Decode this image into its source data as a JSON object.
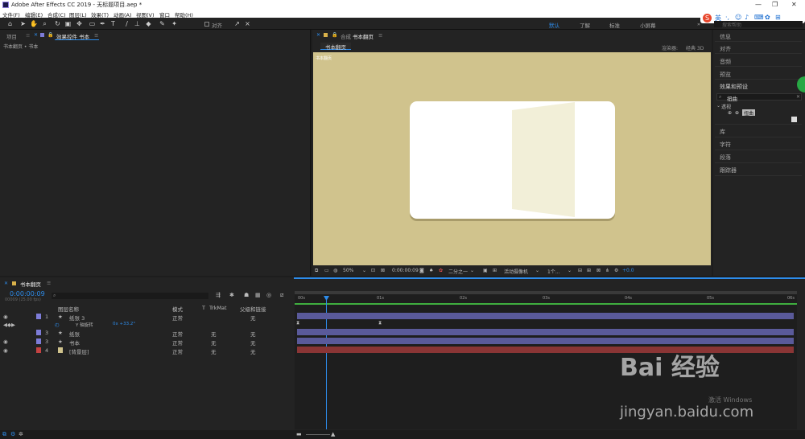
{
  "titlebar": {
    "title": "Adobe After Effects CC 2019 - 无标题项目.aep *",
    "min": "—",
    "max": "❐",
    "close": "✕"
  },
  "menu": [
    "文件(F)",
    "编辑(E)",
    "合成(C)",
    "图层(L)",
    "效果(T)",
    "动画(A)",
    "视图(V)",
    "窗口",
    "帮助(H)"
  ],
  "toolbar": {
    "snap_label": "对齐",
    "workspaces": [
      "默认",
      "了解",
      "标准",
      "小屏幕"
    ],
    "search_placeholder": "搜索帮助"
  },
  "left_panel": {
    "tabs": [
      "项目",
      "效果控件 书本"
    ],
    "breadcrumb": "书本翻页 • 书本"
  },
  "comp_panel": {
    "tab_prefix": "合成",
    "tab_name": "书本翻页",
    "subtab": "书本翻页",
    "renderer_label": "渲染器:",
    "renderer_value": "经典 3D",
    "camera_label": "活动摄像机",
    "zoom": "50%",
    "timecode": "0:00:00:09",
    "resolution": "二分之一",
    "views": "1个...",
    "exposure": "+0.0"
  },
  "right_panel": {
    "items": [
      "信息",
      "对齐",
      "音频",
      "预览",
      "效果和预设",
      "库",
      "字符",
      "段落",
      "跟踪器"
    ],
    "effects_search": "扭曲",
    "effects_folder": "透视"
  },
  "timeline": {
    "tab_label": "书本翻页",
    "timecode": "0:00:00:09",
    "fps_info": "00009 (25.00 fps)",
    "search_placeholder": "",
    "columns": {
      "layer_name": "图层名称",
      "mode": "模式",
      "t": "T",
      "trkmat": "TrkMat",
      "parent": "父级和链接"
    },
    "ruler_labels": [
      "00s",
      "01s",
      "02s",
      "03s",
      "04s",
      "05s",
      "06s"
    ],
    "layers": [
      {
        "num": "1",
        "name": "纸张 3",
        "mode": "正常",
        "trk": "",
        "parent": "无",
        "color": "#7d7cd8",
        "bar": "#5a5a9a"
      },
      {
        "num": "",
        "name": "Y 轴旋转",
        "mode": "",
        "trk": "",
        "parent": "",
        "value": "0x +33.2°",
        "color": "",
        "bar": ""
      },
      {
        "num": "3",
        "name": "纸张",
        "mode": "正常",
        "trk": "无",
        "parent": "无",
        "color": "#7d7cd8",
        "bar": "#5a5a9a"
      },
      {
        "num": "3",
        "name": "书本",
        "mode": "正常",
        "trk": "无",
        "parent": "无",
        "color": "#7d7cd8",
        "bar": "#5a5a9a"
      },
      {
        "num": "4",
        "name": "[背景层]",
        "mode": "正常",
        "trk": "无",
        "parent": "无",
        "color": "#c44242",
        "bar": "#8a3535"
      }
    ]
  },
  "watermark": {
    "logo": "Bai 经验",
    "url": "jingyan.baidu.com"
  },
  "windows_activate": "激活 Windows",
  "ime": {
    "label": "英"
  },
  "colors": {
    "accent": "#2d8ceb",
    "canvas_bg": "#d0c38d",
    "panel": "#232323"
  }
}
